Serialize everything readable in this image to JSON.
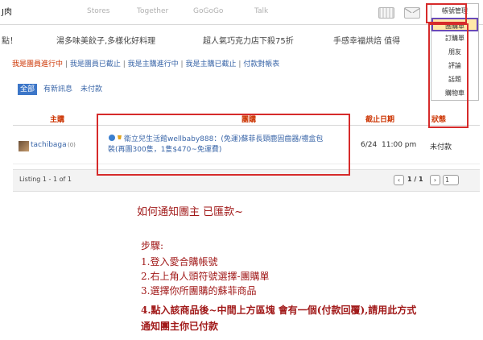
{
  "topnav": {
    "brand": "J肉",
    "links": [
      "Stores",
      "Together",
      "GoGoGo",
      "Talk"
    ],
    "icons": [
      "grid-icon",
      "mail-icon",
      "user-icon"
    ]
  },
  "ticker": [
    "點！",
    "湯多味美餃子,多樣化好料理",
    "超人氣巧克力店下殺75折",
    "手感幸福烘焙 值得"
  ],
  "group_links": {
    "current": "我是團員進行中",
    "others": [
      "我是團員已截止",
      "我是主購進行中",
      "我是主購已截止",
      "付款對帳表"
    ],
    "separator": "|"
  },
  "filters": [
    "全部",
    "有新訊息",
    "未付款"
  ],
  "table": {
    "headers": [
      "主購",
      "團購",
      "截止日期",
      "狀態"
    ],
    "row": {
      "buyer": "tachibaga",
      "buyer_score": "(0)",
      "item_line1": "衛立兒生活館wellbaby888：(免運)蘇菲長頸鹿固齒器/禮盒包",
      "item_line2": "裝(再團300隻，1隻$470~免運費)",
      "deadline_date": "6/24",
      "deadline_time": "11:00 pm",
      "status": "未付款"
    }
  },
  "pager": {
    "listing": "Listing 1 - 1 of 1",
    "page": "1 / 1",
    "page_select": "1"
  },
  "dropdown": {
    "items": [
      "帳號管理",
      "團購單",
      "訂購單",
      "朋友",
      "評論",
      "話題",
      "購物車"
    ],
    "highlighted_index": 1
  },
  "instructions": {
    "title": "如何通知團主 已匯款~",
    "steps_title": "步驟:",
    "steps": [
      "1.登入愛合購帳號",
      "2.右上角人頭符號選擇-團購單",
      "3.選擇你所團購的蘇菲商品"
    ],
    "step4_line1": "4.點入該商品後~中間上方區塊 會有一個(付款回覆),請用此方式",
    "step4_line2": "通知團主你已付款"
  },
  "colors": {
    "annotation_red": "#d62b2b",
    "link_blue": "#3a66a8",
    "header_orange": "#cc3300",
    "active_filter_blue": "#3c76c8",
    "highlight_purple": "#6a49b8"
  }
}
